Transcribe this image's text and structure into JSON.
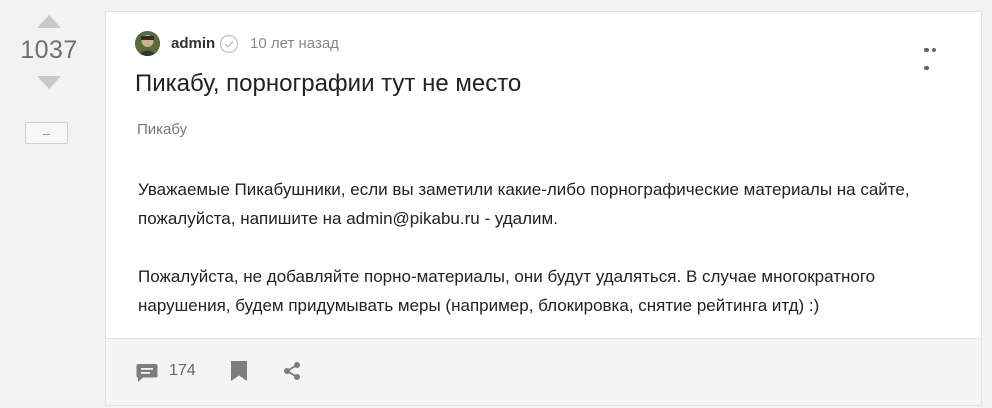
{
  "rating": {
    "score": "1037",
    "collapse_label": "–"
  },
  "post": {
    "author": "admin",
    "time": "10 лет назад",
    "title": "Пикабу, порнографии тут не место",
    "community": "Пикабу",
    "paragraphs": [
      "Уважаемые Пикабушники, если вы заметили какие-либо порнографические материалы на сайте, пожалуйста, напишите на admin@pikabu.ru - удалим.",
      "Пожалуйста, не добавляйте порно-материалы, они будут удаляться. В случае многократного нарушения, будем придумывать меры (например, блокировка, снятие рейтинга итд) :)"
    ],
    "comments_count": "174"
  },
  "icons": {
    "vote_up": "triangle-up-icon",
    "vote_down": "triangle-down-icon",
    "verified": "check-circle-icon",
    "more": "more-dots-icon",
    "comments": "comment-bubble-icon",
    "bookmark": "bookmark-icon",
    "share": "share-icon"
  },
  "colors": {
    "page_bg": "#f2f2f2",
    "card_bg": "#ffffff",
    "muted": "#888888",
    "vote_arrow": "#c9c9c9"
  }
}
